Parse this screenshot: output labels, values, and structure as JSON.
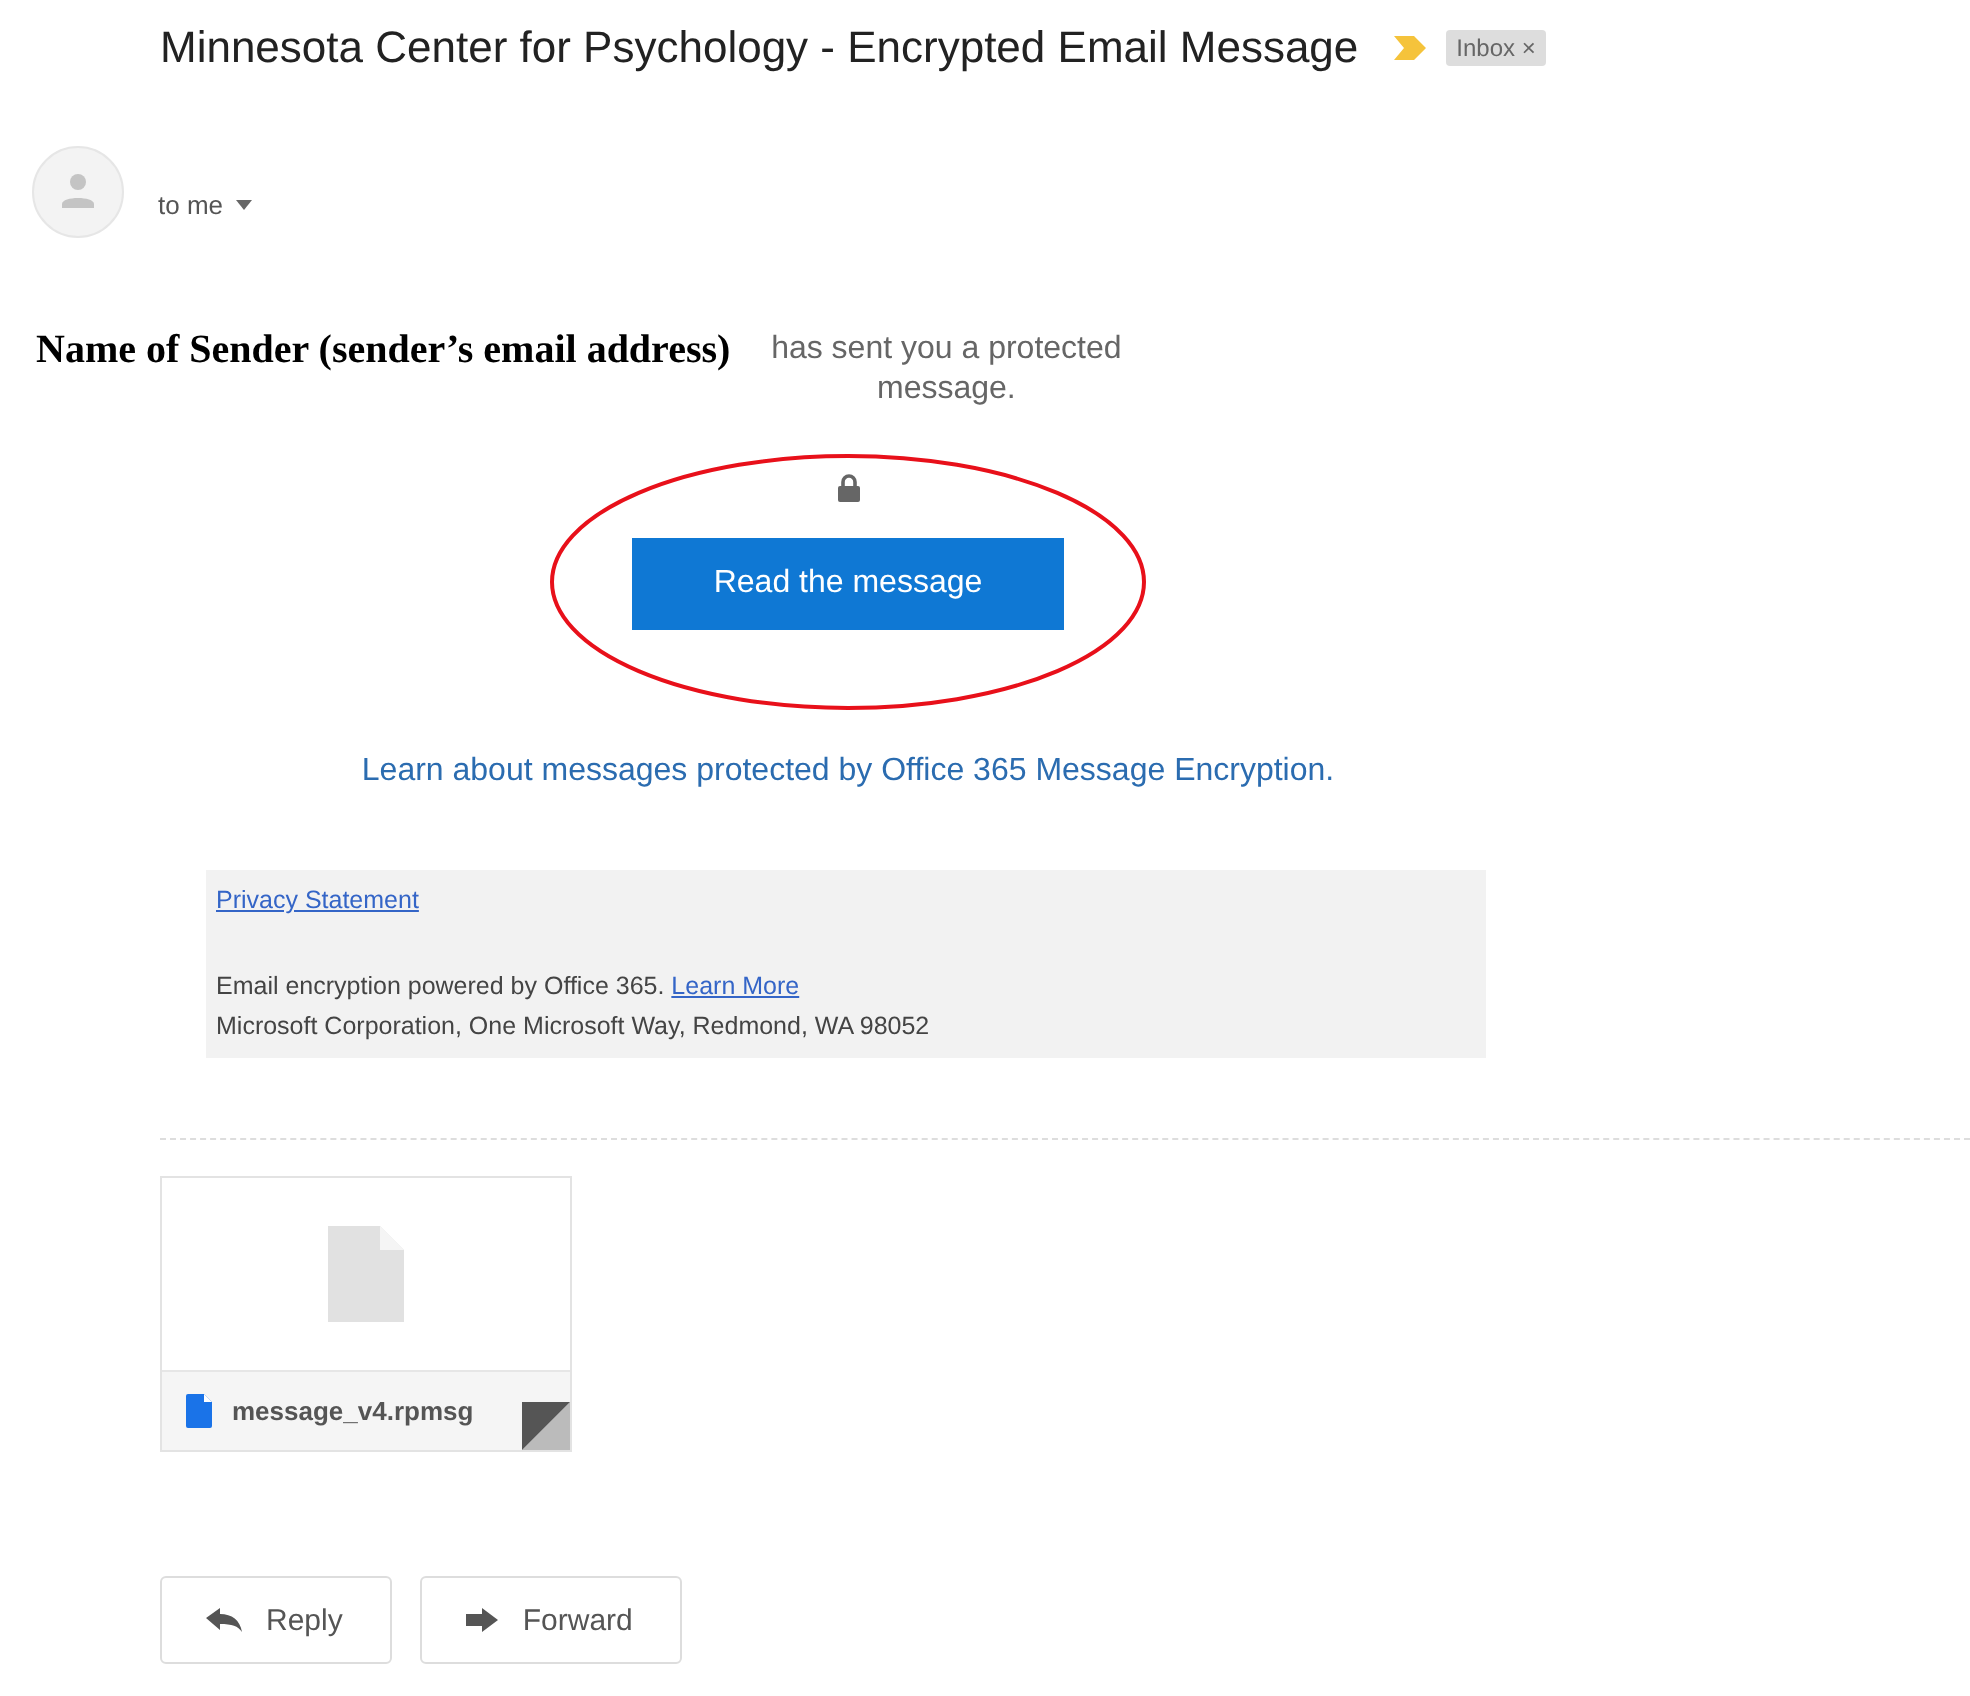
{
  "subject": "Minnesota Center for Psychology - Encrypted Email Message",
  "label": {
    "text": "Inbox",
    "close": "×"
  },
  "recipient": "to me",
  "sender": "Name of Sender (sender’s email address)",
  "notice": "has sent you a protected message.",
  "read_button": "Read the message",
  "learn_link": "Learn about messages protected by Office 365 Message Encryption.",
  "footer": {
    "privacy_link": "Privacy Statement",
    "powered_text": "Email encryption powered by Office 365.",
    "learn_more_link": "Learn More",
    "address": "Microsoft Corporation, One Microsoft Way, Redmond, WA 98052"
  },
  "attachment": {
    "name": "message_v4.rpmsg"
  },
  "actions": [
    "Reply",
    "Forward"
  ]
}
